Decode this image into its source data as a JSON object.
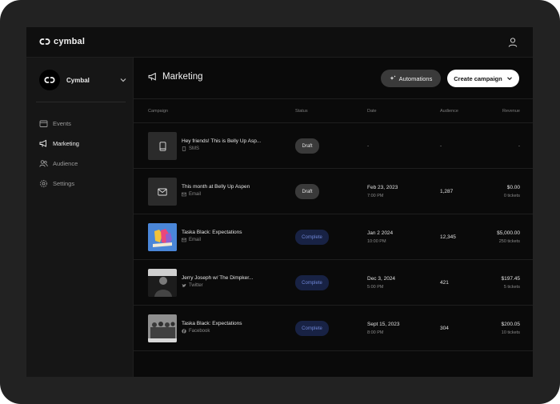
{
  "app": {
    "brand": "cymbal"
  },
  "sidebar": {
    "workspace": "Cymbal",
    "items": [
      {
        "label": "Events",
        "icon": "calendar-icon"
      },
      {
        "label": "Marketing",
        "icon": "megaphone-icon"
      },
      {
        "label": "Audience",
        "icon": "people-icon"
      },
      {
        "label": "Settings",
        "icon": "gear-icon"
      }
    ]
  },
  "header": {
    "title": "Marketing",
    "automations_label": "Automations",
    "create_label": "Create campaign"
  },
  "table": {
    "columns": [
      "Campaign",
      "Status",
      "Date",
      "Audience",
      "Revenue"
    ],
    "rows": [
      {
        "name": "Hey friends! This is Belly Up Asp...",
        "channel": "SMS",
        "status": "Draft",
        "date": "-",
        "time": "",
        "audience": "-",
        "revenue": "-",
        "tickets": ""
      },
      {
        "name": "This month at Belly Up Aspen",
        "channel": "Email",
        "status": "Draft",
        "date": "Feb 23, 2023",
        "time": "7:00 PM",
        "audience": "1,287",
        "revenue": "$0.00",
        "tickets": "0 tickets"
      },
      {
        "name": "Taska Black: Expectations",
        "channel": "Email",
        "status": "Complete",
        "date": "Jan 2 2024",
        "time": "10:00 PM",
        "audience": "12,345",
        "revenue": "$5,000.00",
        "tickets": "250 tickets"
      },
      {
        "name": "Jerry Joseph w/ The Dimpker...",
        "channel": "Twitter",
        "status": "Complete",
        "date": "Dec 3, 2024",
        "time": "5:00 PM",
        "audience": "421",
        "revenue": "$197.45",
        "tickets": "5 tickets"
      },
      {
        "name": "Taska Black: Expectations",
        "channel": "Facebook",
        "status": "Complete",
        "date": "Sept 15, 2023",
        "time": "8:00 PM",
        "audience": "304",
        "revenue": "$200.05",
        "tickets": "10 tickets"
      }
    ]
  },
  "colors": {
    "accent_complete": "#6f86d6",
    "complete_bg": "#182244",
    "draft_bg": "#3a3a3a"
  }
}
